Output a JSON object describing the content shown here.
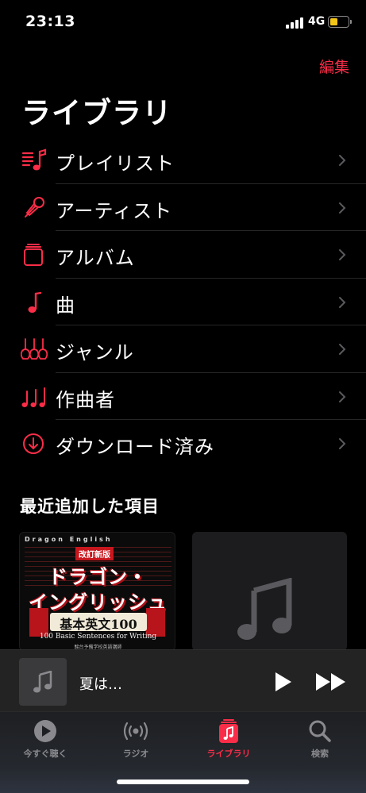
{
  "status_bar": {
    "time": "23:13",
    "network": "4G",
    "battery_level": 0.45,
    "battery_color": "#f2c418"
  },
  "header": {
    "edit_label": "編集",
    "title": "ライブラリ"
  },
  "accent_color": "#fa2d48",
  "library_items": [
    {
      "label": "プレイリスト",
      "icon": "playlist-icon"
    },
    {
      "label": "アーティスト",
      "icon": "microphone-icon"
    },
    {
      "label": "アルバム",
      "icon": "album-stack-icon"
    },
    {
      "label": "曲",
      "icon": "music-note-icon"
    },
    {
      "label": "ジャンル",
      "icon": "guitars-icon"
    },
    {
      "label": "作曲者",
      "icon": "music-notes-icon"
    },
    {
      "label": "ダウンロード済み",
      "icon": "download-circle-icon"
    }
  ],
  "recent": {
    "title": "最近追加した項目",
    "album_cover": {
      "series": "Dragon English",
      "badge": "改訂新版",
      "title_line1": "ドラゴン・",
      "title_line2": "イングリッシュ",
      "band_text": "基本英文100",
      "subtitle": "100 Basic Sentences for Writing",
      "publisher_line": "駿台予備学校英語講師"
    }
  },
  "mini_player": {
    "song": "夏は…"
  },
  "tabs": [
    {
      "label": "今すぐ聴く",
      "icon": "play-circle-icon",
      "active": false
    },
    {
      "label": "ラジオ",
      "icon": "radio-icon",
      "active": false
    },
    {
      "label": "ライブラリ",
      "icon": "library-icon",
      "active": true
    },
    {
      "label": "検索",
      "icon": "search-icon",
      "active": false
    }
  ]
}
